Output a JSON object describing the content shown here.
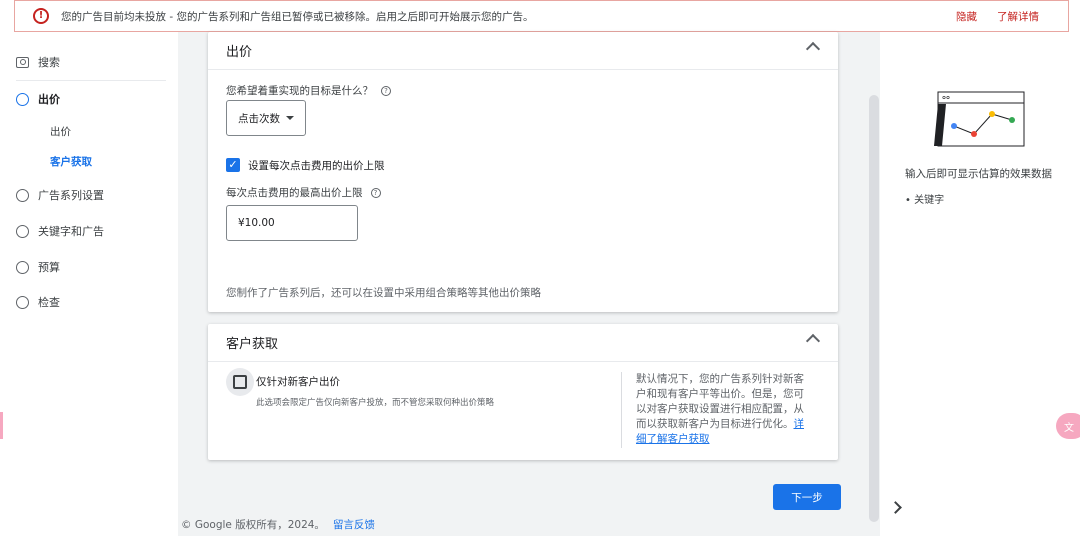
{
  "alert": {
    "message": "您的广告目前均未投放 - 您的广告系列和广告组已暂停或已被移除。启用之后即可开始展示您的广告。",
    "hide_label": "隐藏",
    "learn_label": "了解详情",
    "color": "#c5221f"
  },
  "nav": {
    "search": "搜索",
    "bidding": "出价",
    "sub_bidding": "出价",
    "sub_acquisition": "客户获取",
    "campaign_settings": "广告系列设置",
    "keywords_ads": "关键字和广告",
    "budget": "预算",
    "review": "检查"
  },
  "bidding_card": {
    "title": "出价",
    "goal_question": "您希望着重实现的目标是什么？",
    "goal_value": "点击次数",
    "cap_checkbox_label": "设置每次点击费用的出价上限",
    "cap_checked": true,
    "max_cpc_label": "每次点击费用的最高出价上限",
    "max_cpc_value": "¥10.00",
    "note": "您制作了广告系列后，还可以在设置中采用组合策略等其他出价策略"
  },
  "acquisition_card": {
    "title": "客户获取",
    "checkbox_label": "仅针对新客户出价",
    "checkbox_desc": "此选项会限定广告仅向新客户投放，而不管您采取何种出价策略",
    "side_text": "默认情况下，您的广告系列针对新客户和现有客户平等出价。但是，您可以对客户获取设置进行相应配置，从而以获取新客户为目标进行优化。",
    "side_link": "详细了解客户获取"
  },
  "next_button": "下一步",
  "footer": {
    "copyright": "© Google 版权所有，2024。",
    "feedback": "留言反馈"
  },
  "right_panel": {
    "estimate_text": "输入后即可显示估算的效果数据",
    "bullet_keyword": "关键字"
  },
  "accent": "#1a73e8"
}
